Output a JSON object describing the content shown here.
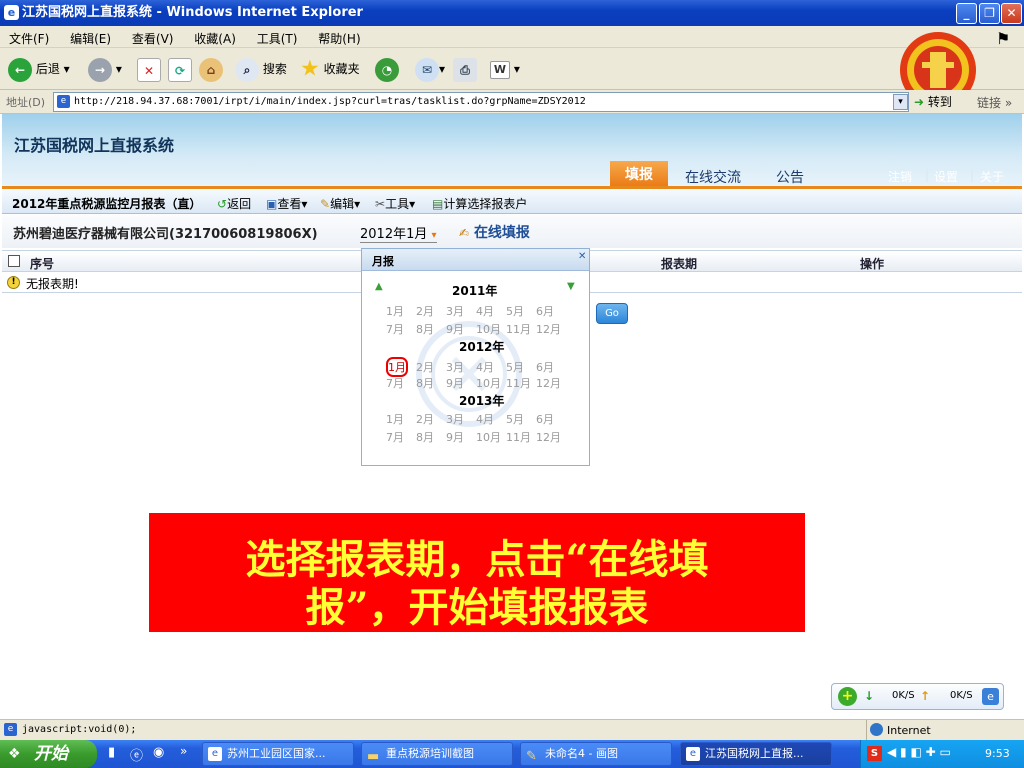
{
  "window": {
    "title": "江苏国税网上直报系统 - Windows Internet Explorer"
  },
  "menu": [
    "文件(F)",
    "编辑(E)",
    "查看(V)",
    "收藏(A)",
    "工具(T)",
    "帮助(H)"
  ],
  "toolbar": {
    "back": "后退",
    "search": "搜索",
    "favorites": "收藏夹"
  },
  "address": {
    "label": "地址(D)",
    "url": "http://218.94.37.68:7001/irpt/i/main/index.jsp?curl=tras/tasklist.do?grpName=ZDSY2012",
    "go": "转到",
    "links": "链接 »"
  },
  "app": {
    "title": "江苏国税网上直报系统",
    "tabs": [
      "填报",
      "在线交流",
      "公告"
    ],
    "top_links": [
      "注销",
      "设置",
      "关于"
    ]
  },
  "report_toolbar": {
    "report_name": "2012年重点税源监控月报表（直）",
    "back": "返回",
    "view": "查看▾",
    "edit": "编辑▾",
    "tools": "工具▾",
    "calc": "计算选择报表户"
  },
  "company": {
    "name": "苏州碧迪医疗器械有限公司(32170060819806X)",
    "period": "2012年1月",
    "online_fill": "在线填报"
  },
  "table": {
    "headers": [
      "序号",
      "报表期",
      "操作"
    ],
    "empty_text": "无报表期!"
  },
  "month_popup": {
    "title": "月报",
    "years": [
      {
        "year": "2011年",
        "row1": [
          "1月",
          "2月",
          "3月",
          "4月",
          "5月",
          "6月"
        ],
        "row2": [
          "7月",
          "8月",
          "9月",
          "10月",
          "11月",
          "12月"
        ]
      },
      {
        "year": "2012年",
        "row1": [
          "1月",
          "2月",
          "3月",
          "4月",
          "5月",
          "6月"
        ],
        "row2": [
          "7月",
          "8月",
          "9月",
          "10月",
          "11月",
          "12月"
        ]
      },
      {
        "year": "2013年",
        "row1": [
          "1月",
          "2月",
          "3月",
          "4月",
          "5月",
          "6月"
        ],
        "row2": [
          "7月",
          "8月",
          "9月",
          "10月",
          "11月",
          "12月"
        ]
      }
    ],
    "selected": "2012年1月"
  },
  "go_button": "Go",
  "banner": {
    "line1": "选择报表期，点击“在线填",
    "line2": "报”，开始填报报表"
  },
  "speed": {
    "down": "0K/S",
    "up": "0K/S"
  },
  "status": {
    "left": "javascript:void(0);",
    "zone": "Internet"
  },
  "taskbar": {
    "start": "开始",
    "tasks": [
      "苏州工业园区国家...",
      "重点税源培训截图",
      "未命名4 - 画图",
      "江苏国税网上直报..."
    ],
    "clock": "9:53"
  }
}
